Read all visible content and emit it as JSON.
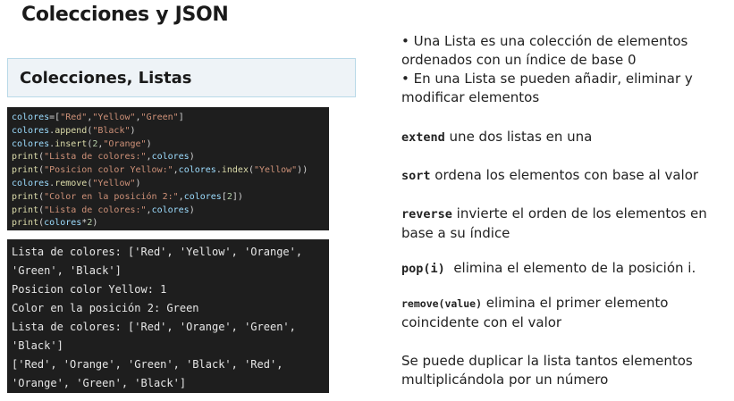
{
  "title": "Colecciones y JSON",
  "section_title": "Colecciones, Listas",
  "code_lines": [
    [
      {
        "t": "colores",
        "c": "id"
      },
      {
        "t": "=[",
        "c": "p"
      },
      {
        "t": "\"Red\"",
        "c": "str"
      },
      {
        "t": ",",
        "c": "p"
      },
      {
        "t": "\"Yellow\"",
        "c": "str"
      },
      {
        "t": ",",
        "c": "p"
      },
      {
        "t": "\"Green\"",
        "c": "str"
      },
      {
        "t": "]",
        "c": "p"
      }
    ],
    [
      {
        "t": "colores",
        "c": "id"
      },
      {
        "t": ".",
        "c": "p"
      },
      {
        "t": "append",
        "c": "fn"
      },
      {
        "t": "(",
        "c": "p"
      },
      {
        "t": "\"Black\"",
        "c": "str"
      },
      {
        "t": ")",
        "c": "p"
      }
    ],
    [
      {
        "t": "colores",
        "c": "id"
      },
      {
        "t": ".",
        "c": "p"
      },
      {
        "t": "insert",
        "c": "fn"
      },
      {
        "t": "(",
        "c": "p"
      },
      {
        "t": "2",
        "c": "num"
      },
      {
        "t": ",",
        "c": "p"
      },
      {
        "t": "\"Orange\"",
        "c": "str"
      },
      {
        "t": ")",
        "c": "p"
      }
    ],
    [
      {
        "t": "print",
        "c": "fn"
      },
      {
        "t": "(",
        "c": "p"
      },
      {
        "t": "\"Lista de colores:\"",
        "c": "str"
      },
      {
        "t": ",",
        "c": "p"
      },
      {
        "t": "colores",
        "c": "id"
      },
      {
        "t": ")",
        "c": "p"
      }
    ],
    [
      {
        "t": "print",
        "c": "fn"
      },
      {
        "t": "(",
        "c": "p"
      },
      {
        "t": "\"Posicion color Yellow:\"",
        "c": "str"
      },
      {
        "t": ",",
        "c": "p"
      },
      {
        "t": "colores",
        "c": "id"
      },
      {
        "t": ".",
        "c": "p"
      },
      {
        "t": "index",
        "c": "fn"
      },
      {
        "t": "(",
        "c": "p"
      },
      {
        "t": "\"Yellow\"",
        "c": "str"
      },
      {
        "t": "))",
        "c": "p"
      }
    ],
    [
      {
        "t": "colores",
        "c": "id"
      },
      {
        "t": ".",
        "c": "p"
      },
      {
        "t": "remove",
        "c": "fn"
      },
      {
        "t": "(",
        "c": "p"
      },
      {
        "t": "\"Yellow\"",
        "c": "str"
      },
      {
        "t": ")",
        "c": "p"
      }
    ],
    [
      {
        "t": "print",
        "c": "fn"
      },
      {
        "t": "(",
        "c": "p"
      },
      {
        "t": "\"Color en la posición 2:\"",
        "c": "str"
      },
      {
        "t": ",",
        "c": "p"
      },
      {
        "t": "colores",
        "c": "id"
      },
      {
        "t": "[",
        "c": "p"
      },
      {
        "t": "2",
        "c": "num"
      },
      {
        "t": "])",
        "c": "p"
      }
    ],
    [
      {
        "t": "print",
        "c": "fn"
      },
      {
        "t": "(",
        "c": "p"
      },
      {
        "t": "\"Lista de colores:\"",
        "c": "str"
      },
      {
        "t": ",",
        "c": "p"
      },
      {
        "t": "colores",
        "c": "id"
      },
      {
        "t": ")",
        "c": "p"
      }
    ],
    [
      {
        "t": "print",
        "c": "fn"
      },
      {
        "t": "(",
        "c": "p"
      },
      {
        "t": "colores",
        "c": "id"
      },
      {
        "t": "*",
        "c": "p"
      },
      {
        "t": "2",
        "c": "num"
      },
      {
        "t": ")",
        "c": "p"
      }
    ]
  ],
  "output_lines": [
    "Lista de colores: ['Red', 'Yellow', 'Orange',",
    "'Green', 'Black']",
    "Posicion color Yellow: 1",
    "Color en la posición 2: Green",
    "Lista de colores: ['Red', 'Orange', 'Green',",
    "'Black']",
    "['Red', 'Orange', 'Green', 'Black', 'Red',",
    "'Orange', 'Green', 'Black']"
  ],
  "bullets": {
    "b1_line1": "• Una Lista es una colección de elementos",
    "b1_line2": "ordenados con un índice de base 0",
    "b2_line1": "• En una Lista se pueden añadir, eliminar y",
    "b2_line2": "modificar elementos"
  },
  "methods": {
    "extend_kw": "extend",
    "extend_desc": " une dos listas en una",
    "sort_kw": "sort",
    "sort_desc": " ordena los elementos con base al valor",
    "reverse_kw": "reverse",
    "reverse_desc1": " invierte el orden de los elementos en",
    "reverse_desc2": "base a su índice",
    "pop_kw": "pop(i)",
    "pop_desc": "  elimina el elemento de la posición i.",
    "remove_kw": "remove(value)",
    "remove_desc1": " elimina el primer elemento",
    "remove_desc2": "coincidente con el valor"
  },
  "duplicate": {
    "line1": "Se puede duplicar la lista tantos elementos",
    "line2": "multiplicándola por un número"
  },
  "colors": {
    "identifier": "#9cdcfe",
    "function": "#dcdcaa",
    "string": "#ce9178",
    "punct": "#d4d4d4",
    "number": "#b5cea8",
    "code_bg": "#1e1e1e"
  }
}
